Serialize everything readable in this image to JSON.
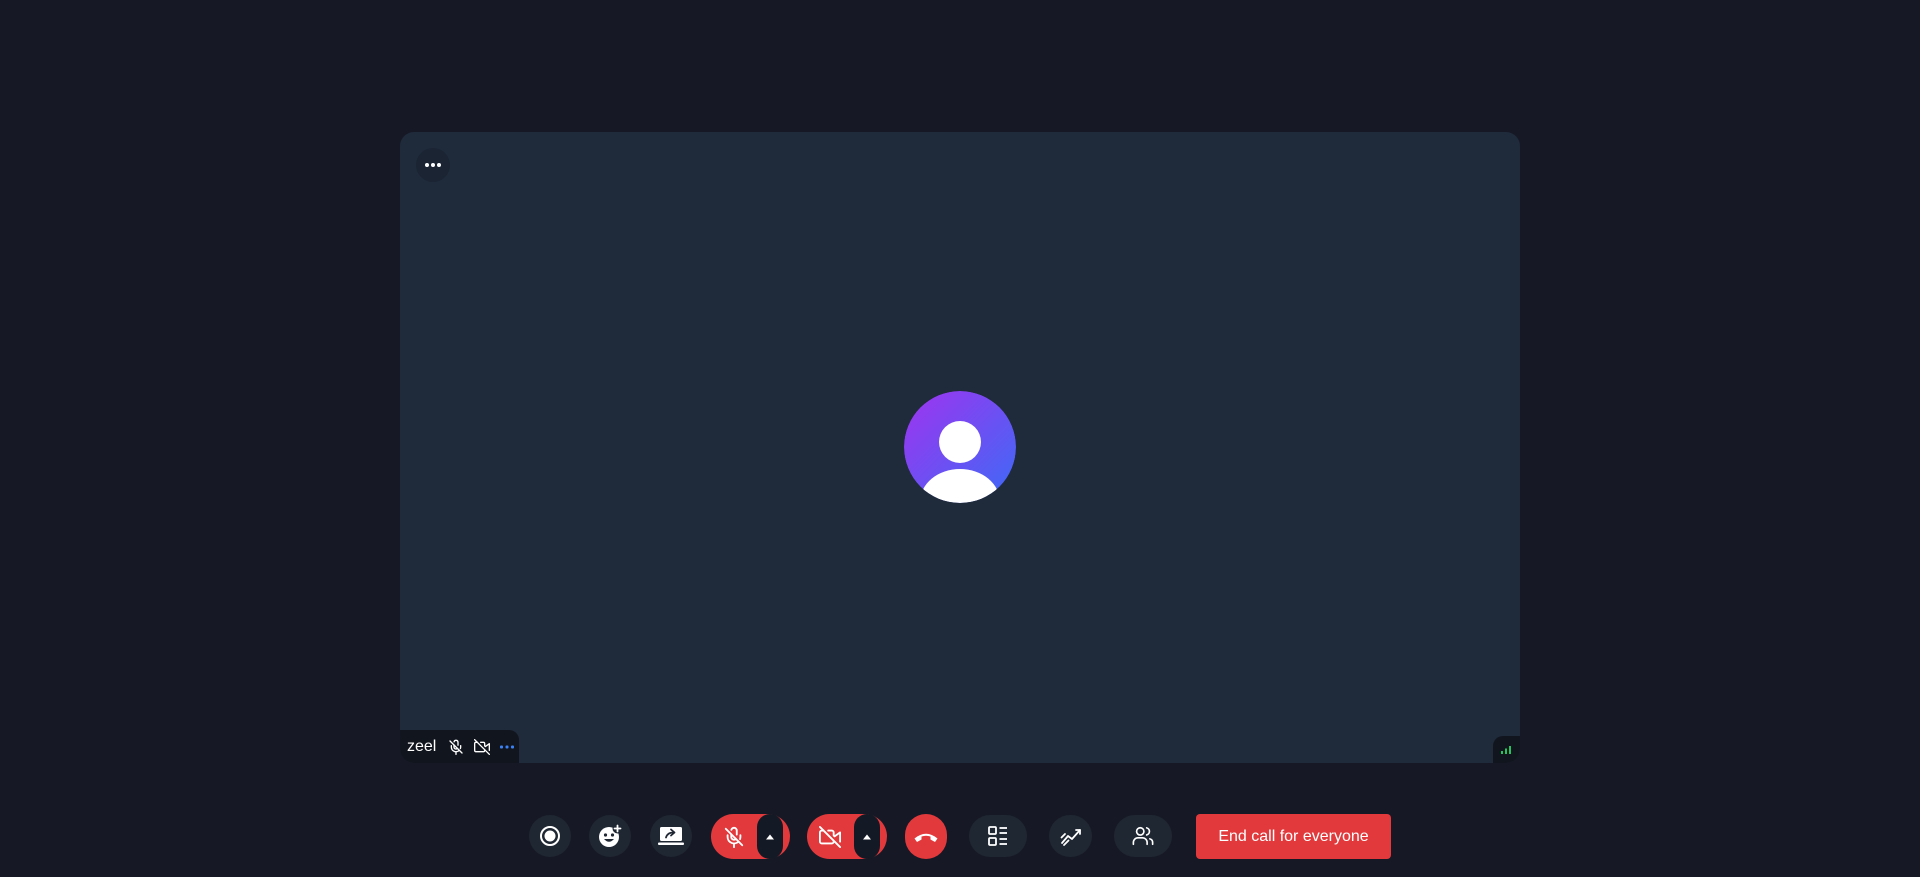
{
  "participant": {
    "name": "zeel"
  },
  "icons": {
    "tile_menu": "more-horizontal-icon",
    "avatar": "user-avatar-icon",
    "name_mic": "mic-off-icon",
    "name_cam": "video-off-icon",
    "name_more": "more-horizontal-icon",
    "signal": "signal-strength-icon",
    "record": "record-icon",
    "reactions": "emoji-add-icon",
    "share": "screen-share-icon",
    "mic": "mic-off-icon",
    "cam": "video-off-icon",
    "caret": "chevron-up-icon",
    "hangup": "phone-hangup-icon",
    "layout": "layout-grid-icon",
    "whiteboard": "whiteboard-icon",
    "participants": "participants-icon"
  },
  "toolbar": {
    "end_all_label": "End call for everyone"
  },
  "colors": {
    "background": "#161925",
    "tile": "#1f2a3b",
    "danger": "#e23a3c",
    "control": "#1f2733",
    "signal_good": "#22c55e",
    "accent": "#3b82f6"
  }
}
